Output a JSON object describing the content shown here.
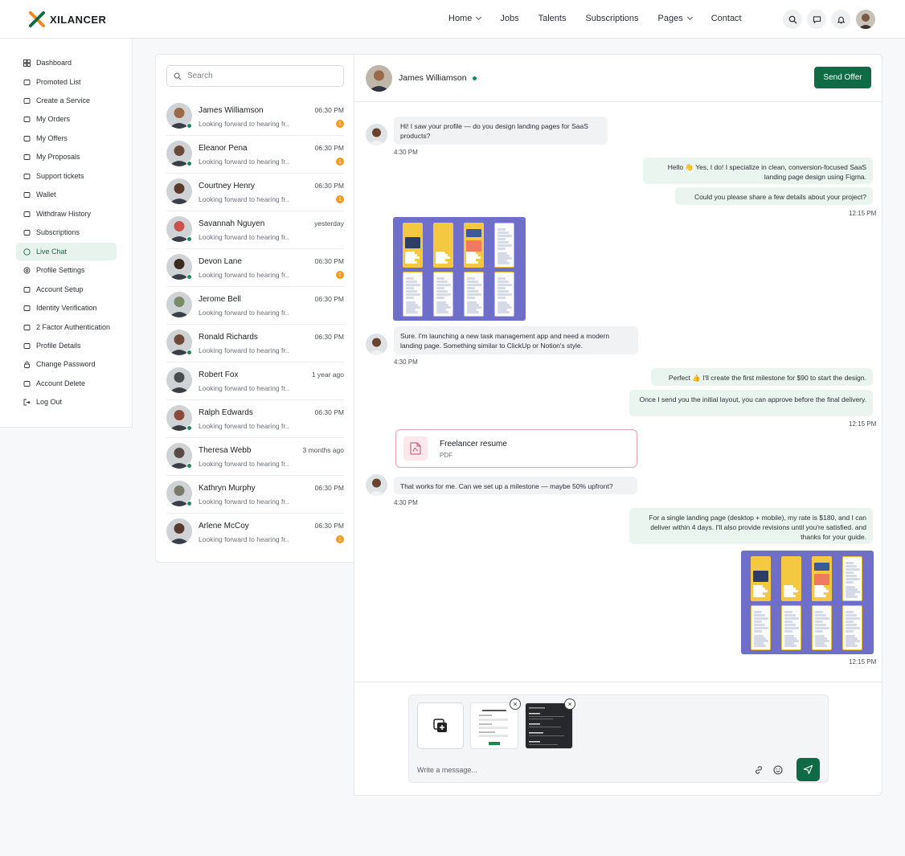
{
  "brand": {
    "name": "XILANCER"
  },
  "nav": {
    "items": [
      {
        "label": "Home",
        "dropdown": true
      },
      {
        "label": "Jobs",
        "dropdown": false
      },
      {
        "label": "Talents",
        "dropdown": false
      },
      {
        "label": "Subscriptions",
        "dropdown": false
      },
      {
        "label": "Pages",
        "dropdown": true
      },
      {
        "label": "Contact",
        "dropdown": false
      }
    ],
    "icons": [
      "search-icon",
      "chat-icon",
      "bell-icon"
    ]
  },
  "sidebar": {
    "items": [
      {
        "label": "Dashboard",
        "icon": "grid-icon"
      },
      {
        "label": "Promoted List",
        "icon": "megaphone-icon"
      },
      {
        "label": "Create a Service",
        "icon": "briefcase-icon"
      },
      {
        "label": "My Orders",
        "icon": "clipboard-icon"
      },
      {
        "label": "My Offers",
        "icon": "offer-icon"
      },
      {
        "label": "My Proposals",
        "icon": "list-icon"
      },
      {
        "label": "Support tickets",
        "icon": "ticket-icon"
      },
      {
        "label": "Wallet",
        "icon": "wallet-icon"
      },
      {
        "label": "Withdraw History",
        "icon": "history-icon"
      },
      {
        "label": "Subscriptions",
        "icon": "crown-icon"
      },
      {
        "label": "Live Chat",
        "icon": "chat-bubble-icon",
        "active": true
      },
      {
        "label": "Profile Settings",
        "icon": "gear-icon"
      },
      {
        "label": "Account Setup",
        "icon": "user-gear-icon"
      },
      {
        "label": "Identity Verification",
        "icon": "scan-icon"
      },
      {
        "label": "2 Factor Authentication",
        "icon": "shield-check-icon"
      },
      {
        "label": "Profile Details",
        "icon": "id-card-icon"
      },
      {
        "label": "Change Password",
        "icon": "lock-icon"
      },
      {
        "label": "Account Delete",
        "icon": "trash-icon"
      },
      {
        "label": "Log Out",
        "icon": "logout-icon"
      }
    ]
  },
  "search": {
    "placeholder": "Search"
  },
  "conversations": [
    {
      "name": "James Williamson",
      "time": "06:30 PM",
      "preview": "Looking forward to hearing fr..",
      "unread": "1",
      "online": true,
      "skin": "#9a6a4a"
    },
    {
      "name": "Eleanor Pena",
      "time": "06:30 PM",
      "preview": "Looking forward to hearing fr..",
      "unread": "1",
      "online": true,
      "skin": "#6b4a3a"
    },
    {
      "name": "Courtney Henry",
      "time": "06:30 PM",
      "preview": "Looking forward to hearing fr..",
      "unread": "1",
      "online": false,
      "skin": "#5a3a2a"
    },
    {
      "name": "Savannah Nguyen",
      "time": "yesterday",
      "preview": "Looking forward to hearing fr..",
      "unread": "",
      "online": true,
      "skin": "#c9534a"
    },
    {
      "name": "Devon Lane",
      "time": "06:30 PM",
      "preview": "Looking forward to hearing fr..",
      "unread": "1",
      "online": true,
      "skin": "#3d2a20"
    },
    {
      "name": "Jerome Bell",
      "time": "06:30 PM",
      "preview": "Looking forward to hearing fr..",
      "unread": "",
      "online": false,
      "skin": "#7a8a6a"
    },
    {
      "name": "Ronald Richards",
      "time": "06:30 PM",
      "preview": "Looking forward to hearing fr..",
      "unread": "",
      "online": true,
      "skin": "#6a4a3a"
    },
    {
      "name": "Robert Fox",
      "time": "1 year ago",
      "preview": "Looking forward to hearing fr..",
      "unread": "",
      "online": false,
      "skin": "#4a4a4a"
    },
    {
      "name": "Ralph Edwards",
      "time": "06:30 PM",
      "preview": "Looking forward to hearing fr..",
      "unread": "",
      "online": true,
      "skin": "#8a4a3a"
    },
    {
      "name": "Theresa Webb",
      "time": "3 months ago",
      "preview": "Looking forward to hearing fr..",
      "unread": "",
      "online": true,
      "skin": "#5a4a44"
    },
    {
      "name": "Kathryn Murphy",
      "time": "06:30 PM",
      "preview": "Looking forward to hearing fr..",
      "unread": "",
      "online": true,
      "skin": "#7a7a6a"
    },
    {
      "name": "Arlene McCoy",
      "time": "06:30 PM",
      "preview": "Looking forward to hearing fr..",
      "unread": "1",
      "online": false,
      "skin": "#5a3a30"
    }
  ],
  "chat": {
    "contact_name": "James Williamson",
    "send_offer_label": "Send Offer",
    "messages": {
      "m1": "Hi! I saw your profile — do you design landing pages for SaaS products?",
      "m1_time": "4:30 PM",
      "m2": "Hello 👋 Yes, I do! I specialize in clean, conversion-focused SaaS landing page design using Figma.",
      "m3": "Could you please share a few details about your project?",
      "m3_time": "12:15 PM",
      "m4": "Sure. I'm launching a new task management app and need a modern landing page. Something similar to ClickUp or Notion's style.",
      "m4_time": "4:30 PM",
      "m5": "Perfect 👍 I'll create the first milestone for $90 to start the design.",
      "m6": "Once I send you the initial layout, you can approve before the final delivery.",
      "m6_time": "12:15 PM",
      "file_name": "Freelancer resume",
      "file_type": "PDF",
      "m7": "That works for me. Can we set up a milestone — maybe 50% upfront?",
      "m7_time": "4:30 PM",
      "m8": "For a single landing page (desktop + mobile), my rate is $180, and I can deliver within 4 days. I'll also provide revisions until you're satisfied. and thanks for your guide.",
      "m9_time": "12:15 PM"
    },
    "composer_placeholder": "Write a message..."
  },
  "colors": {
    "brand_green": "#0f6b45",
    "accent_orange": "#f29a1f",
    "mock_purple": "#6f6fc9",
    "mock_yellow": "#f5c842"
  }
}
